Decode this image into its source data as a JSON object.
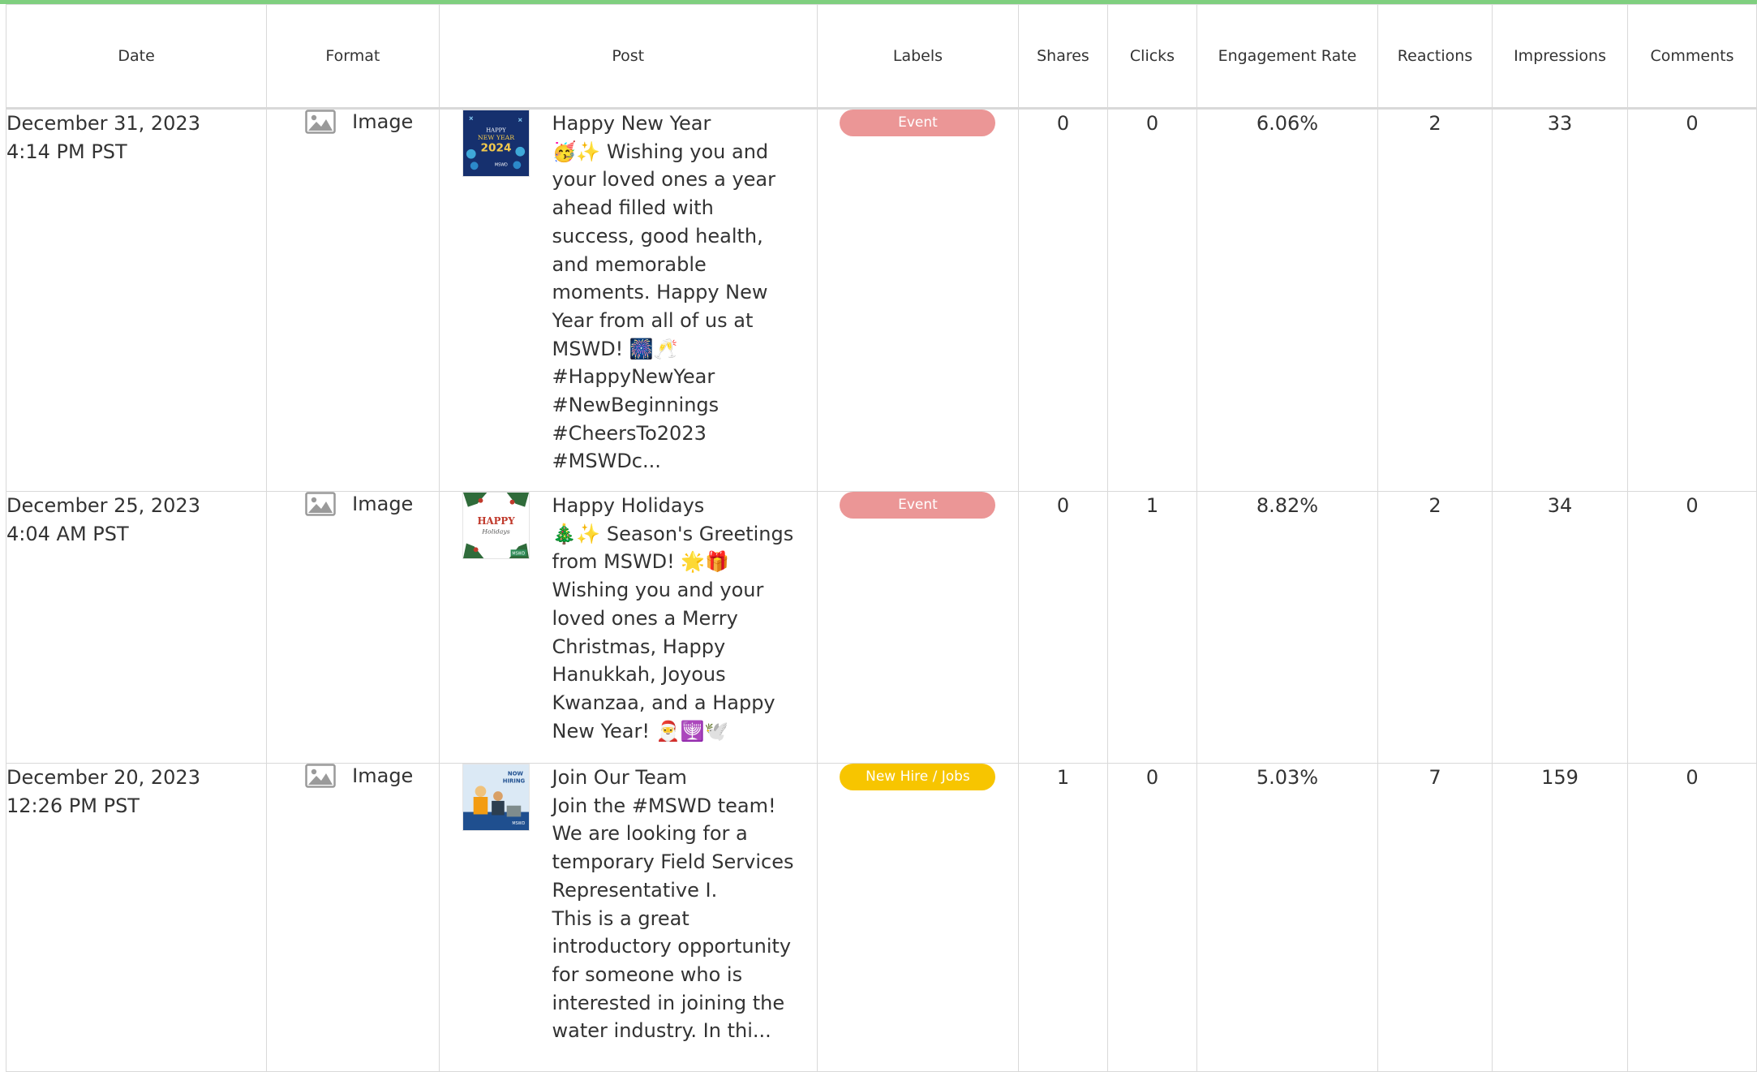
{
  "colors": {
    "accent_bar": "#7fcf7f",
    "label_event": "#eb9696",
    "label_jobs": "#f7c500",
    "grid_border": "#d9d9d9",
    "text": "#333333"
  },
  "table": {
    "headers": [
      "Date",
      "Format",
      "Post",
      "Labels",
      "Shares",
      "Clicks",
      "Engagement Rate",
      "Reactions",
      "Impressions",
      "Comments"
    ],
    "rows": [
      {
        "date": "December 31, 2023",
        "time": "4:14 PM PST",
        "format_icon": "image-icon",
        "format": "Image",
        "thumb_icon": "happy-new-year-2024-thumbnail",
        "thumb_text": {
          "l1": "HAPPY",
          "l2": "NEW YEAR",
          "l3": "2024",
          "logo": "MSWD"
        },
        "post_title": "Happy New Year",
        "post_body": "🥳✨ Wishing you and your loved ones a year ahead filled with success, good health, and memorable moments. Happy New Year from all of us at MSWD! 🎆🥂\n#HappyNewYear\n#NewBeginnings\n#CheersTo2023\n#MSWDc...",
        "label": "Event",
        "label_color": "#eb9696",
        "shares": "0",
        "clicks": "0",
        "engagement_rate": "6.06%",
        "reactions": "2",
        "impressions": "33",
        "comments": "0"
      },
      {
        "date": "December 25, 2023",
        "time": "4:04 AM PST",
        "format_icon": "image-icon",
        "format": "Image",
        "thumb_icon": "happy-holidays-thumbnail",
        "thumb_text": {
          "l1": "HAPPY",
          "l2": "Holidays",
          "logo": "MSWD"
        },
        "post_title": "Happy Holidays",
        "post_body": "🎄✨ Season's Greetings from MSWD! 🌟🎁\nWishing you and your loved ones a Merry Christmas, Happy Hanukkah, Joyous Kwanzaa, and a Happy New Year! 🎅🕎🕊️",
        "label": "Event",
        "label_color": "#eb9696",
        "shares": "0",
        "clicks": "1",
        "engagement_rate": "8.82%",
        "reactions": "2",
        "impressions": "34",
        "comments": "0"
      },
      {
        "date": "December 20, 2023",
        "time": "12:26 PM PST",
        "format_icon": "image-icon",
        "format": "Image",
        "thumb_icon": "now-hiring-thumbnail",
        "thumb_text": {
          "l1": "NOW",
          "l2": "HIRING",
          "logo": "MSWD"
        },
        "post_title": "Join Our Team",
        "post_body": "Join the #MSWD team! We are looking for a temporary Field Services Representative I.\nThis is a great introductory opportunity for someone who is interested in joining the water industry. In thi...",
        "label": "New Hire / Jobs",
        "label_color": "#f7c500",
        "shares": "1",
        "clicks": "0",
        "engagement_rate": "5.03%",
        "reactions": "7",
        "impressions": "159",
        "comments": "0"
      }
    ]
  }
}
